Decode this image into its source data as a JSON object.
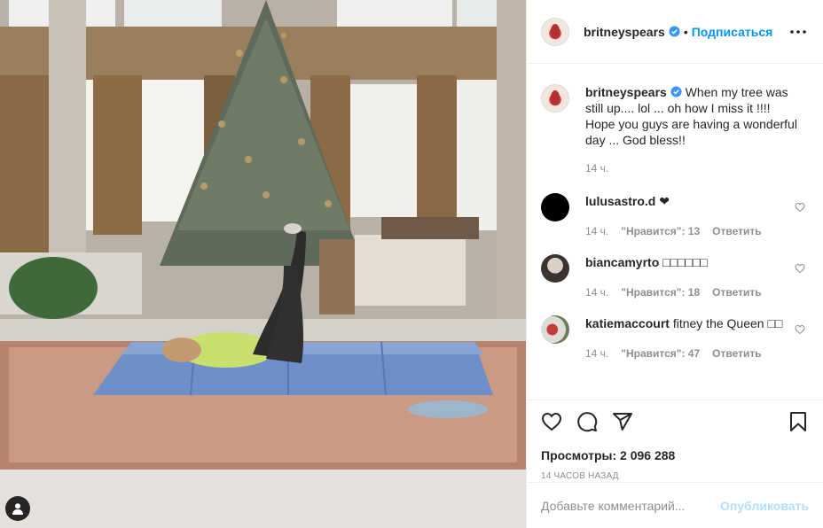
{
  "post": {
    "username": "britneyspears",
    "follow_label": "Подписаться",
    "separator": "•"
  },
  "caption": {
    "username": "britneyspears",
    "text": "When my tree was still up.... lol ... oh how I miss it !!!! Hope you guys are having a wonderful day ... God bless!!",
    "time": "14 ч."
  },
  "comments": [
    {
      "username": "lulusastro.d",
      "text": "❤",
      "time": "14 ч.",
      "likes": "\"Нравится\": 13",
      "reply": "Ответить"
    },
    {
      "username": "biancamyrto",
      "text": "□□□□□□",
      "time": "14 ч.",
      "likes": "\"Нравится\": 18",
      "reply": "Ответить"
    },
    {
      "username": "katiemaccourt",
      "text": "fitney the Queen □□",
      "time": "14 ч.",
      "likes": "\"Нравится\": 47",
      "reply": "Ответить"
    }
  ],
  "stats": {
    "views": "Просмотры: 2 096 288",
    "time_ago": "14 часов назад"
  },
  "add_comment": {
    "placeholder": "Добавьте комментарий...",
    "publish": "Опубликовать"
  },
  "colors": {
    "accent": "#0095f6",
    "verified": "#3897f0",
    "publish_disabled": "#b2dffc"
  }
}
